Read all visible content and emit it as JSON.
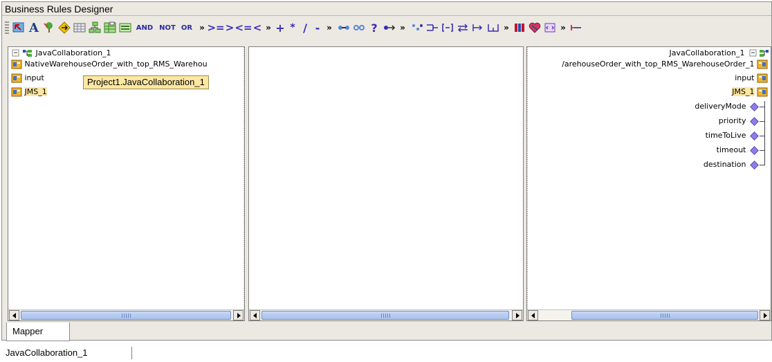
{
  "window": {
    "title": "Business Rules Designer"
  },
  "toolbar": {
    "buttons": [
      {
        "name": "select-icon"
      },
      {
        "name": "text-icon",
        "label": "A"
      },
      {
        "name": "tree-icon"
      },
      {
        "name": "arrow-icon"
      },
      {
        "name": "table-icon"
      },
      {
        "name": "hierarchy-icon"
      },
      {
        "name": "grid-icon"
      },
      {
        "name": "form-icon"
      },
      {
        "name": "and-operator",
        "label": "AND"
      },
      {
        "name": "not-operator",
        "label": "NOT"
      },
      {
        "name": "or-operator",
        "label": "OR"
      },
      {
        "name": "more-1",
        "label": "»"
      },
      {
        "name": "gte-operator",
        "label": ">="
      },
      {
        "name": "gt-operator",
        "label": ">"
      },
      {
        "name": "lte-operator",
        "label": "<="
      },
      {
        "name": "lt-operator",
        "label": "<"
      },
      {
        "name": "more-2",
        "label": "»"
      },
      {
        "name": "plus-operator",
        "label": "+"
      },
      {
        "name": "multiply-operator",
        "label": "*"
      },
      {
        "name": "divide-operator",
        "label": "/"
      },
      {
        "name": "minus-operator",
        "label": "-"
      },
      {
        "name": "more-3",
        "label": "»"
      }
    ]
  },
  "left_pane": {
    "root": "JavaCollaboration_1",
    "items": [
      {
        "label": "NativeWarehouseOrder_with_top_RMS_Warehou"
      },
      {
        "label": "input"
      },
      {
        "label": "JMS_1"
      }
    ],
    "tooltip": "Project1.JavaCollaboration_1"
  },
  "right_pane": {
    "root": "JavaCollaboration_1",
    "items": [
      {
        "label": "/arehouseOrder_with_top_RMS_WarehouseOrder_1"
      },
      {
        "label": "input"
      },
      {
        "label": "JMS_1"
      }
    ],
    "fields": [
      {
        "label": "deliveryMode"
      },
      {
        "label": "priority"
      },
      {
        "label": "timeToLive"
      },
      {
        "label": "timeout"
      },
      {
        "label": "destination"
      }
    ]
  },
  "tabs": {
    "mapper": "Mapper"
  },
  "status": {
    "text": "JavaCollaboration_1"
  },
  "colors": {
    "highlight": "#fde7a3",
    "diamond": "#8f7ee6",
    "scroll_thumb": "#a8c0ec"
  }
}
